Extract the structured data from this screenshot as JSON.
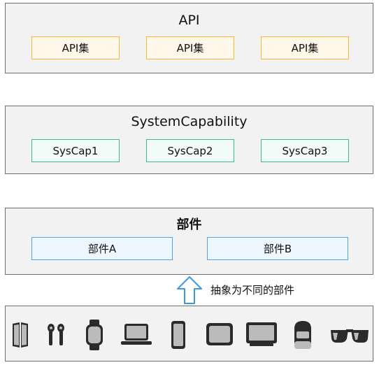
{
  "api_layer": {
    "title": "API",
    "items": [
      "API集",
      "API集",
      "API集"
    ]
  },
  "syscap_layer": {
    "title": "SystemCapability",
    "items": [
      "SysCap1",
      "SysCap2",
      "SysCap3"
    ]
  },
  "component_layer": {
    "title": "部件",
    "items": [
      "部件A",
      "部件B"
    ]
  },
  "abstraction_label": "抽象为不同的部件",
  "devices": [
    "foldable-phone-icon",
    "earbuds-icon",
    "smartwatch-icon",
    "laptop-icon",
    "phone-icon",
    "tablet-icon",
    "smart-screen-icon",
    "smart-speaker-icon",
    "smart-glasses-icon"
  ],
  "colors": {
    "api_border": "#f2b92e",
    "api_fill": "#fff8ea",
    "syscap_border": "#3db893",
    "syscap_fill": "#f1fbf7",
    "component_border": "#4fa3e6",
    "component_fill": "#eef7fe",
    "arrow_border": "#3f96e0",
    "layer_fill": "#f2f2f2"
  }
}
